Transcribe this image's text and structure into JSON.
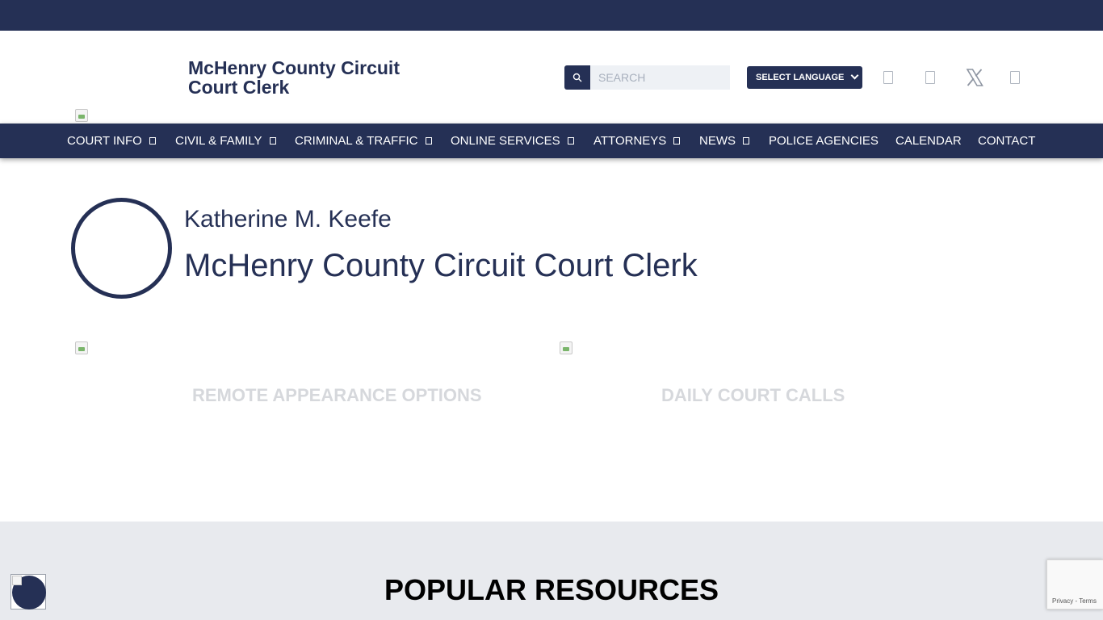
{
  "header": {
    "site_title": "McHenry County Circuit Court Clerk",
    "search": {
      "placeholder": "SEARCH",
      "button_icon": "search-icon"
    },
    "language_select": {
      "selected": "SELECT LANGUAGE"
    },
    "social_icons": [
      "facebook-icon",
      "instagram-icon",
      "x-twitter-icon",
      "youtube-icon"
    ],
    "x_glyph": "𝕏"
  },
  "nav": {
    "items": [
      {
        "label": "COURT INFO",
        "has_dropdown": true
      },
      {
        "label": "CIVIL & FAMILY",
        "has_dropdown": true
      },
      {
        "label": "CRIMINAL & TRAFFIC",
        "has_dropdown": true
      },
      {
        "label": "ONLINE SERVICES",
        "has_dropdown": true
      },
      {
        "label": "ATTORNEYS",
        "has_dropdown": true
      },
      {
        "label": "NEWS",
        "has_dropdown": true
      },
      {
        "label": "POLICE AGENCIES",
        "has_dropdown": false
      },
      {
        "label": "CALENDAR",
        "has_dropdown": false
      },
      {
        "label": "CONTACT",
        "has_dropdown": false
      }
    ]
  },
  "hero": {
    "clerk_name": "Katherine M. Keefe",
    "office_title": "McHenry County Circuit Court Clerk"
  },
  "cards": [
    {
      "label": "REMOTE APPEARANCE OPTIONS"
    },
    {
      "label": "DAILY COURT CALLS"
    }
  ],
  "resources": {
    "title": "POPULAR RESOURCES"
  },
  "recaptcha": {
    "links": "Privacy - Terms"
  },
  "colors": {
    "brand_navy": "#253055",
    "section_gray": "#e8eaee",
    "card_label_gray": "#d6d8dc"
  }
}
